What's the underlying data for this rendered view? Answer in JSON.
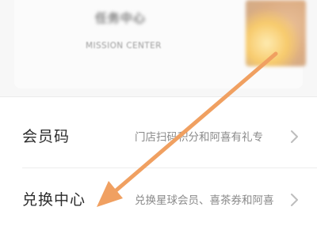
{
  "mission": {
    "title": "任务中心",
    "subtitle": "MISSION CENTER"
  },
  "list": {
    "items": [
      {
        "label": "会员码",
        "description": "门店扫码积分和阿喜有礼专"
      },
      {
        "label": "兑换中心",
        "description": "兑换星球会员、喜茶券和阿喜"
      }
    ]
  },
  "colors": {
    "annotation_arrow": "#f0a061",
    "label_text": "#2b2b2b",
    "description_text": "#8a8a8a"
  }
}
